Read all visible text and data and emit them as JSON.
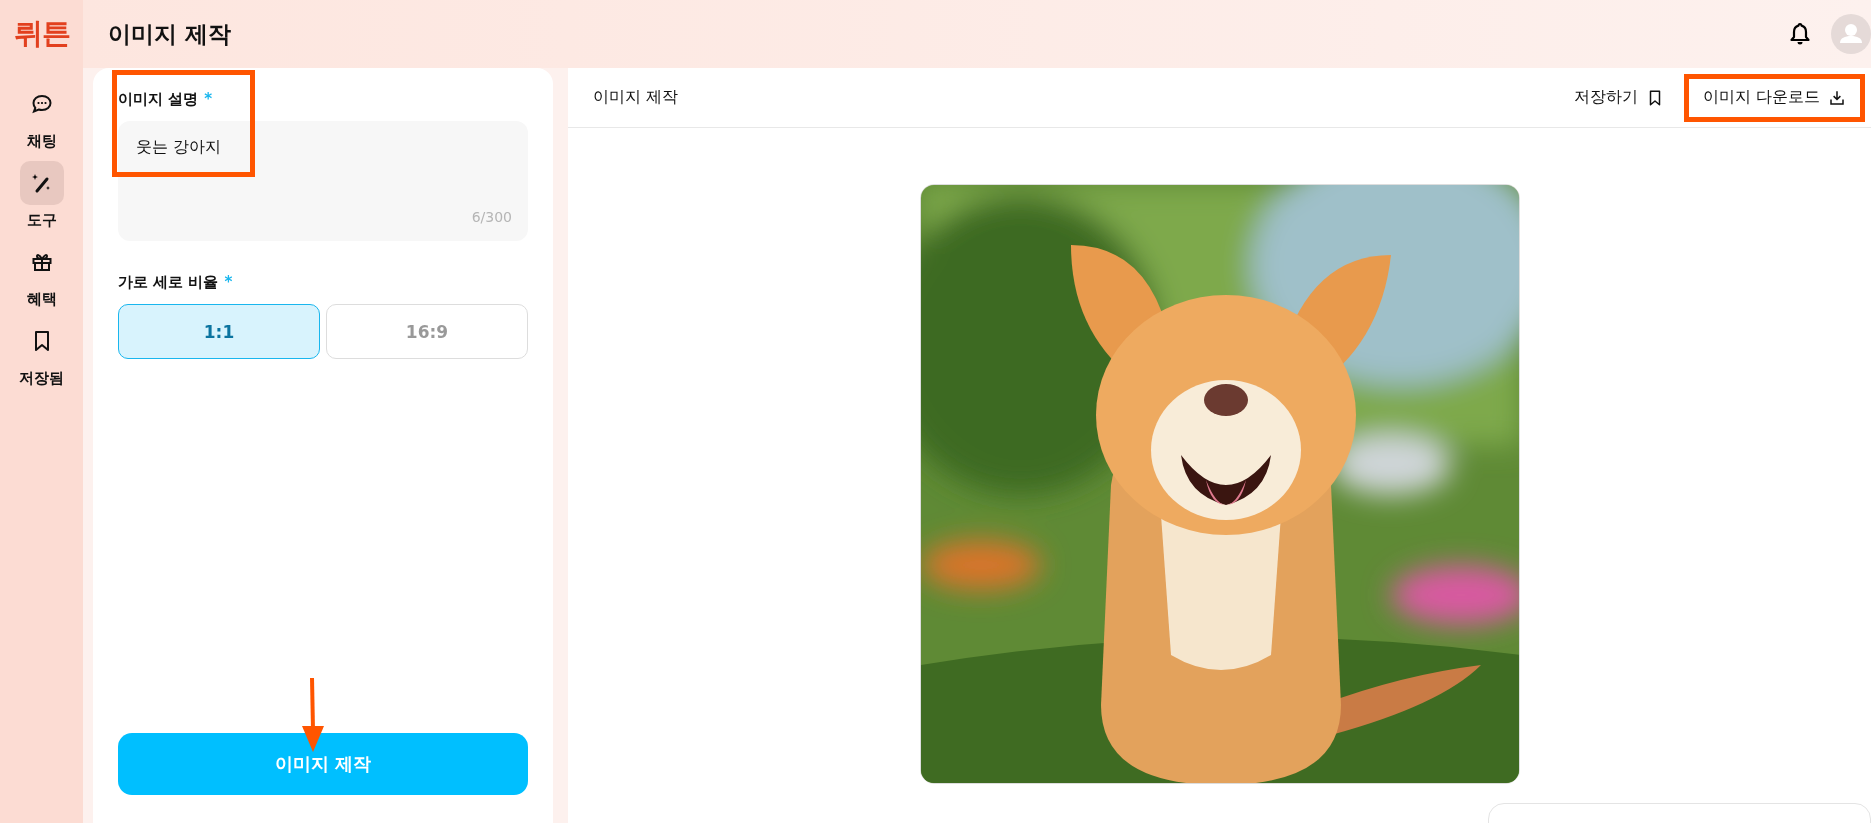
{
  "logo": "뤼튼",
  "nav": [
    {
      "label": "채팅",
      "selected": false
    },
    {
      "label": "도구",
      "selected": true
    },
    {
      "label": "혜택",
      "selected": false
    },
    {
      "label": "저장됨",
      "selected": false
    }
  ],
  "page_title": "이미지 제작",
  "form": {
    "description": {
      "label": "이미지 설명",
      "required_mark": "*",
      "value": "웃는 강아지",
      "counter": "6/300",
      "highlighted": true
    },
    "ratio": {
      "label": "가로 세로 비율",
      "required_mark": "*",
      "options": [
        {
          "label": "1:1",
          "selected": true
        },
        {
          "label": "16:9",
          "selected": false
        }
      ]
    },
    "generate_button": {
      "label": "이미지 제작",
      "pointed": true
    }
  },
  "result": {
    "title": "이미지 제작",
    "actions": [
      {
        "label": "저장하기",
        "highlighted": false
      },
      {
        "label": "이미지 다운로드",
        "highlighted": true
      }
    ]
  }
}
